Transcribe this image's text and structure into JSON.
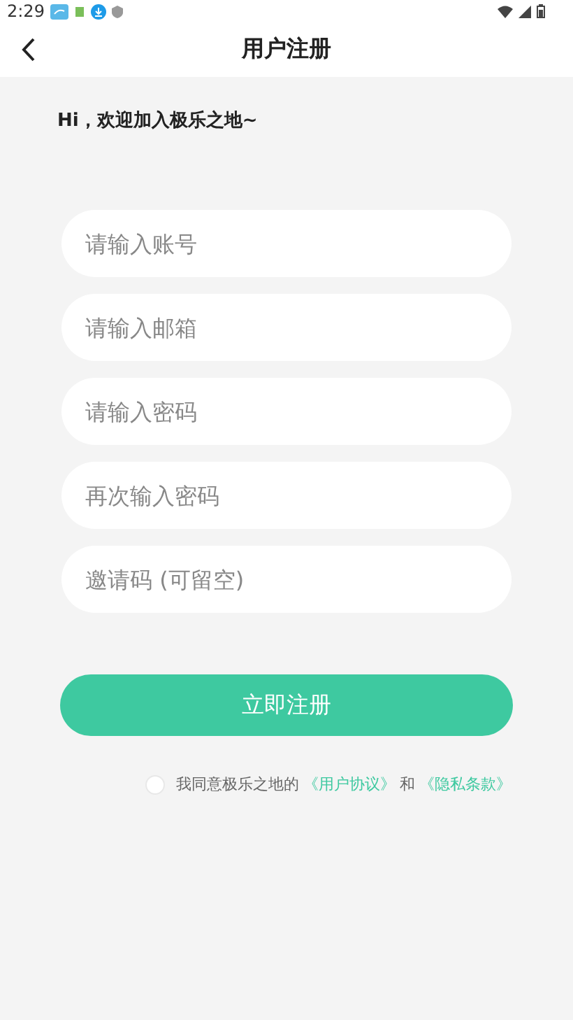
{
  "status_bar": {
    "time": "2:29"
  },
  "header": {
    "title": "用户注册"
  },
  "greeting": "Hi，欢迎加入极乐之地~",
  "fields": [
    {
      "placeholder": "请输入账号"
    },
    {
      "placeholder": "请输入邮箱"
    },
    {
      "placeholder": "请输入密码"
    },
    {
      "placeholder": "再次输入密码"
    },
    {
      "placeholder": "邀请码 (可留空)"
    }
  ],
  "submit_button": "立即注册",
  "agreement": {
    "checked": false,
    "text": "我同意极乐之地的",
    "link_1": "《用户协议》",
    "joiner": "和",
    "link_2": "《隐私条款》"
  }
}
